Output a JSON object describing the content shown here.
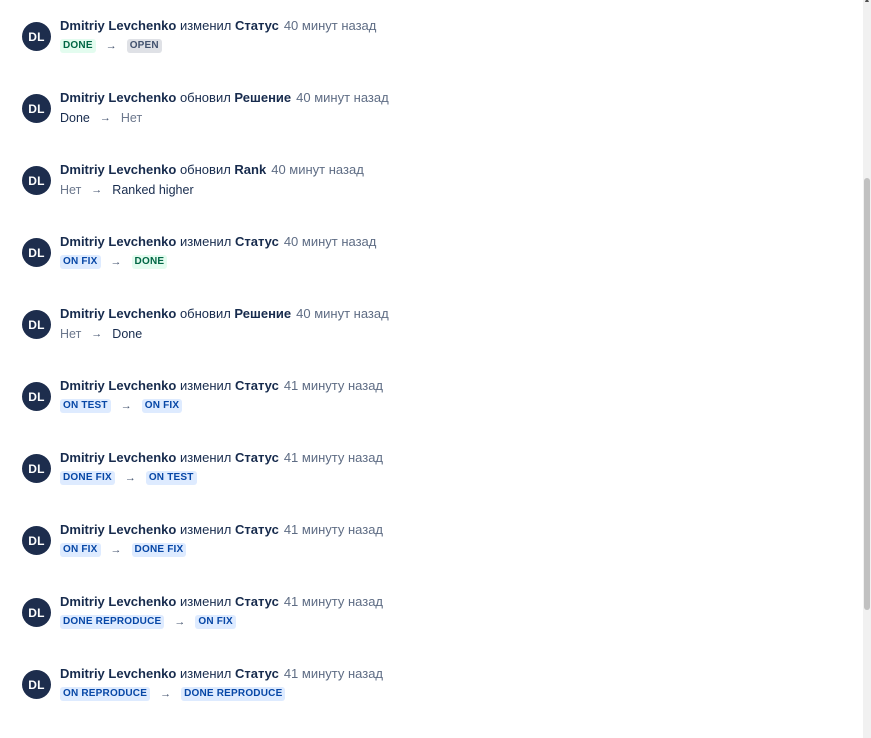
{
  "user_name": "Dmitriy Levchenko",
  "avatar_initials": "DL",
  "arrow_glyph": "→",
  "entries": [
    {
      "action": "изменил",
      "field": "Статус",
      "time": "40 минут назад",
      "from": "DONE",
      "to": "OPEN",
      "from_style": "green",
      "to_style": "grey",
      "kind": "status"
    },
    {
      "action": "обновил",
      "field": "Решение",
      "time": "40 минут назад",
      "from": "Done",
      "to": "Нет",
      "kind": "text"
    },
    {
      "action": "обновил",
      "field": "Rank",
      "time": "40 минут назад",
      "from": "Нет",
      "to": "Ranked higher",
      "kind": "text"
    },
    {
      "action": "изменил",
      "field": "Статус",
      "time": "40 минут назад",
      "from": "ON FIX",
      "to": "DONE",
      "from_style": "blue",
      "to_style": "green",
      "kind": "status"
    },
    {
      "action": "обновил",
      "field": "Решение",
      "time": "40 минут назад",
      "from": "Нет",
      "to": "Done",
      "kind": "text"
    },
    {
      "action": "изменил",
      "field": "Статус",
      "time": "41 минуту назад",
      "from": "ON TEST",
      "to": "ON FIX",
      "from_style": "blue",
      "to_style": "blue",
      "kind": "status"
    },
    {
      "action": "изменил",
      "field": "Статус",
      "time": "41 минуту назад",
      "from": "DONE FIX",
      "to": "ON TEST",
      "from_style": "blue",
      "to_style": "blue",
      "kind": "status"
    },
    {
      "action": "изменил",
      "field": "Статус",
      "time": "41 минуту назад",
      "from": "ON FIX",
      "to": "DONE FIX",
      "from_style": "blue",
      "to_style": "blue",
      "kind": "status"
    },
    {
      "action": "изменил",
      "field": "Статус",
      "time": "41 минуту назад",
      "from": "DONE REPRODUCE",
      "to": "ON FIX",
      "from_style": "blue",
      "to_style": "blue",
      "kind": "status"
    },
    {
      "action": "изменил",
      "field": "Статус",
      "time": "41 минуту назад",
      "from": "ON REPRODUCE",
      "to": "DONE REPRODUCE",
      "from_style": "blue",
      "to_style": "blue",
      "kind": "status"
    }
  ]
}
